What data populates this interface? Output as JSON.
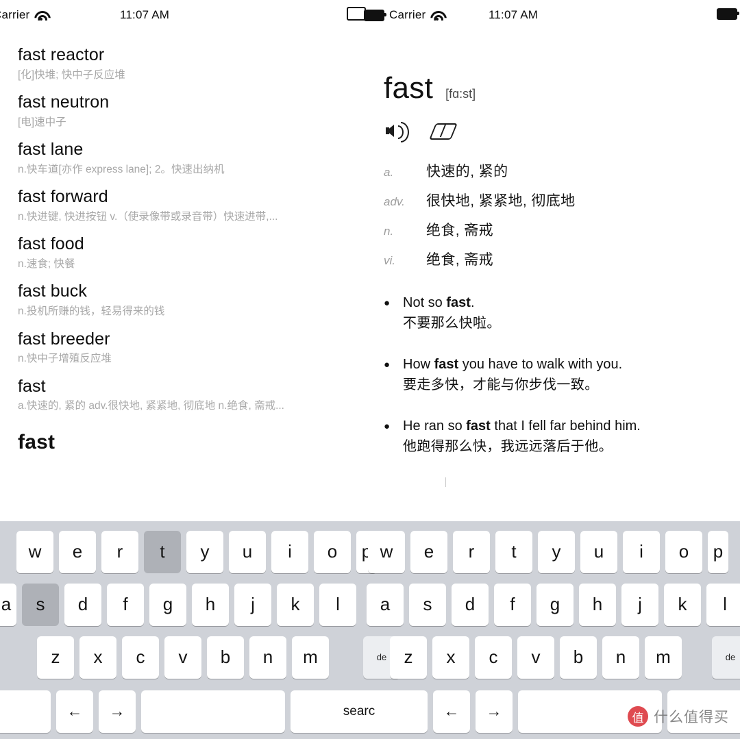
{
  "status_bars": [
    {
      "carrier": "Carrier",
      "time": "11:07 AM",
      "wifi_icon": "wifi-icon",
      "battery_icon": "battery-icon"
    },
    {
      "carrier": "Carrier",
      "time": "11:07 AM",
      "wifi_icon": "wifi-icon",
      "battery_icon": "battery-icon"
    }
  ],
  "wordlist": {
    "items": [
      {
        "term": "fast reactor",
        "definition": "[化]快堆; 快中子反应堆"
      },
      {
        "term": "fast neutron",
        "definition": "[电]速中子"
      },
      {
        "term": "fast lane",
        "definition": "n.快车道[亦作 express lane]; 2。快速出纳机"
      },
      {
        "term": "fast forward",
        "definition": "n.快进键, 快进按钮 v.（使录像带或录音带）快速进带,..."
      },
      {
        "term": "fast food",
        "definition": "n.速食; 快餐"
      },
      {
        "term": "fast buck",
        "definition": "n.投机所赚的钱，轻易得来的钱"
      },
      {
        "term": "fast breeder",
        "definition": "n.快中子增殖反应堆"
      },
      {
        "term": "fast",
        "definition": "a.快速的, 紧的 adv.很快地, 紧紧地, 彻底地 n.绝食, 斋戒..."
      }
    ],
    "query": "fast"
  },
  "definition": {
    "headword": "fast",
    "phonetic": "[fɑ:st]",
    "speaker_icon": "speaker-icon",
    "eraser_icon": "eraser-icon",
    "senses": [
      {
        "pos": "a.",
        "meaning": "快速的, 紧的"
      },
      {
        "pos": "adv.",
        "meaning": "很快地, 紧紧地, 彻底地"
      },
      {
        "pos": "n.",
        "meaning": "绝食, 斋戒"
      },
      {
        "pos": "vi.",
        "meaning": "绝食, 斋戒"
      }
    ],
    "examples": [
      {
        "en_prefix": "Not so ",
        "en_bold": "fast",
        "en_suffix": ".",
        "zh": "不要那么快啦。"
      },
      {
        "en_prefix": "How ",
        "en_bold": "fast",
        "en_suffix": " you have to walk with you.",
        "zh": "要走多快，才能与你步伐一致。"
      },
      {
        "en_prefix": "He ran so ",
        "en_bold": "fast",
        "en_suffix": " that I fell far behind him.",
        "zh": "他跑得那么快，我远远落后于他。"
      }
    ]
  },
  "keyboard": {
    "left": {
      "row1": [
        "w",
        "e",
        "r",
        "t",
        "y",
        "u",
        "i",
        "o",
        "p"
      ],
      "row1_pressed": "t",
      "row2": [
        "a",
        "s",
        "d",
        "f",
        "g",
        "h",
        "j",
        "k",
        "l"
      ],
      "row2_pressed": "s",
      "row3": [
        "z",
        "x",
        "c",
        "v",
        "b",
        "n",
        "m"
      ],
      "row3_end_label": "de",
      "bottom": [
        "",
        "←",
        "→",
        ""
      ]
    },
    "right": {
      "row1": [
        "w",
        "e",
        "r",
        "t",
        "y",
        "u",
        "i",
        "o",
        "p"
      ],
      "row2": [
        "a",
        "s",
        "d",
        "f",
        "g",
        "h",
        "j",
        "k",
        "l"
      ],
      "row3": [
        "z",
        "x",
        "c",
        "v",
        "b",
        "n",
        "m"
      ],
      "row3_end_label": "de",
      "search_label": "searc",
      "bottom": [
        "←",
        "→",
        "",
        ""
      ]
    }
  },
  "watermark": {
    "logo_text": "值",
    "text": "什么值得买"
  }
}
